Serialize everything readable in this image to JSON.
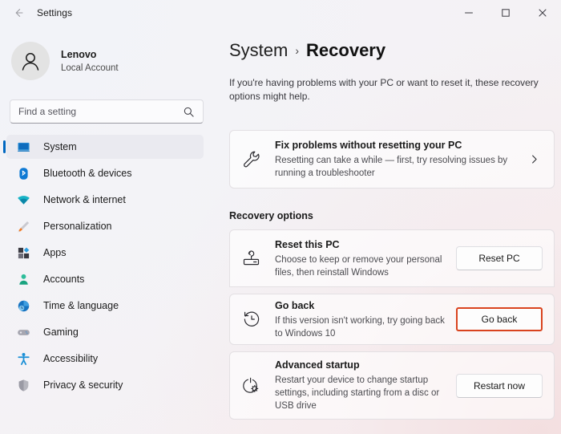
{
  "window": {
    "title": "Settings",
    "back_icon": "back-arrow-icon",
    "minimize_label": "Minimize",
    "maximize_label": "Maximize",
    "close_label": "Close"
  },
  "account": {
    "name": "Lenovo",
    "type": "Local Account",
    "avatar_icon": "person-avatar-icon"
  },
  "search": {
    "placeholder": "Find a setting",
    "value": "",
    "icon": "search-icon"
  },
  "sidebar": {
    "items": [
      {
        "label": "System",
        "icon": "monitor-icon",
        "selected": true
      },
      {
        "label": "Bluetooth & devices",
        "icon": "bluetooth-icon",
        "selected": false
      },
      {
        "label": "Network & internet",
        "icon": "wifi-icon",
        "selected": false
      },
      {
        "label": "Personalization",
        "icon": "paintbrush-icon",
        "selected": false
      },
      {
        "label": "Apps",
        "icon": "apps-grid-icon",
        "selected": false
      },
      {
        "label": "Accounts",
        "icon": "person-icon",
        "selected": false
      },
      {
        "label": "Time & language",
        "icon": "clock-icon",
        "selected": false
      },
      {
        "label": "Gaming",
        "icon": "gamepad-icon",
        "selected": false
      },
      {
        "label": "Accessibility",
        "icon": "accessibility-person-icon",
        "selected": false
      },
      {
        "label": "Privacy & security",
        "icon": "shield-icon",
        "selected": false
      }
    ]
  },
  "page": {
    "breadcrumb_parent": "System",
    "breadcrumb_separator": "›",
    "breadcrumb_current": "Recovery",
    "description": "If you're having problems with your PC or want to reset it, these recovery options might help.",
    "section_heading": "Recovery options"
  },
  "fix_card": {
    "title": "Fix problems without resetting your PC",
    "subtitle": "Resetting can take a while — first, try resolving issues by running a troubleshooter",
    "icon": "wrench-icon",
    "chevron_icon": "chevron-right-icon"
  },
  "options": [
    {
      "title": "Reset this PC",
      "subtitle": "Choose to keep or remove your personal files, then reinstall Windows",
      "icon": "reset-pc-icon",
      "button_label": "Reset PC",
      "highlighted": false
    },
    {
      "title": "Go back",
      "subtitle": "If this version isn't working, try going back to Windows 10",
      "icon": "history-clock-icon",
      "button_label": "Go back",
      "highlighted": true
    },
    {
      "title": "Advanced startup",
      "subtitle": "Restart your device to change startup settings, including starting from a disc or USB drive",
      "icon": "power-gear-icon",
      "button_label": "Restart now",
      "highlighted": false
    }
  ],
  "colors": {
    "accent": "#0067c0",
    "highlight_border": "#d9431e",
    "sidebar_selected_bg": "#eaeaf0",
    "text_primary": "#1a1a1a",
    "text_secondary": "#4b4b50"
  }
}
